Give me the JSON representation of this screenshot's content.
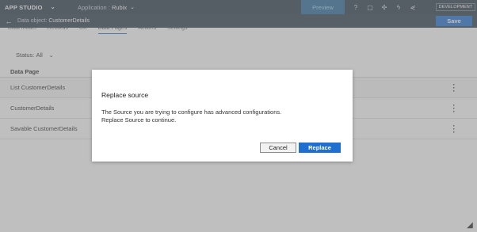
{
  "topbar": {
    "studio": "APP STUDIO",
    "app_prefix": "Application :",
    "app_name": "Rubix",
    "preview": "Preview",
    "environment": "DEVELOPMENT"
  },
  "subbar": {
    "crumb_prefix": "Data object:",
    "crumb_name": "CustomerDetails",
    "save": "Save"
  },
  "tabs": [
    "Data model",
    "Records",
    "UX",
    "Data Pages",
    "Actions",
    "Settings"
  ],
  "filter": {
    "label": "Status:",
    "value": "All"
  },
  "table": {
    "header": "Data Page",
    "rows": [
      "List CustomerDetails",
      "CustomerDetails",
      "Savable CustomerDetails"
    ]
  },
  "modal": {
    "title": "Replace source",
    "line1": "The Source you are trying to configure has advanced configurations.",
    "line2": "Replace Source to continue.",
    "cancel": "Cancel",
    "replace": "Replace"
  }
}
